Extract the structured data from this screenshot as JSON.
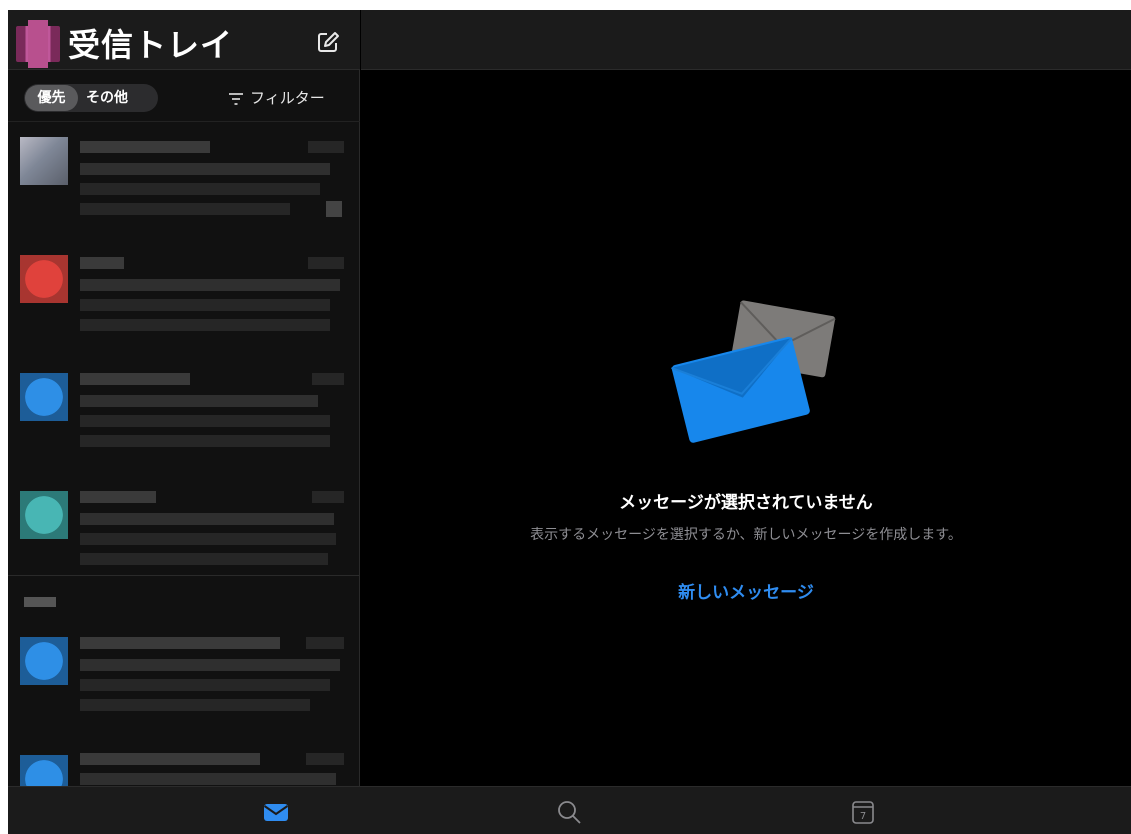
{
  "header": {
    "title": "受信トレイ",
    "compose_icon": "compose-icon"
  },
  "filter_bar": {
    "focused_label": "優先",
    "other_label": "その他",
    "filter_label": "フィルター",
    "filter_icon": "filter-icon"
  },
  "empty_state": {
    "title": "メッセージが選択されていません",
    "subtitle": "表示するメッセージを選択するか、新しいメッセージを作成します。",
    "action_label": "新しいメッセージ"
  },
  "tab_bar": {
    "tabs": [
      {
        "icon": "mail-icon",
        "active": true
      },
      {
        "icon": "search-icon",
        "active": false
      },
      {
        "icon": "calendar-icon",
        "active": false,
        "glyph": "7"
      }
    ]
  },
  "colors": {
    "accent": "#2f8cf0",
    "background": "#000000",
    "panel": "#1b1b1b"
  }
}
